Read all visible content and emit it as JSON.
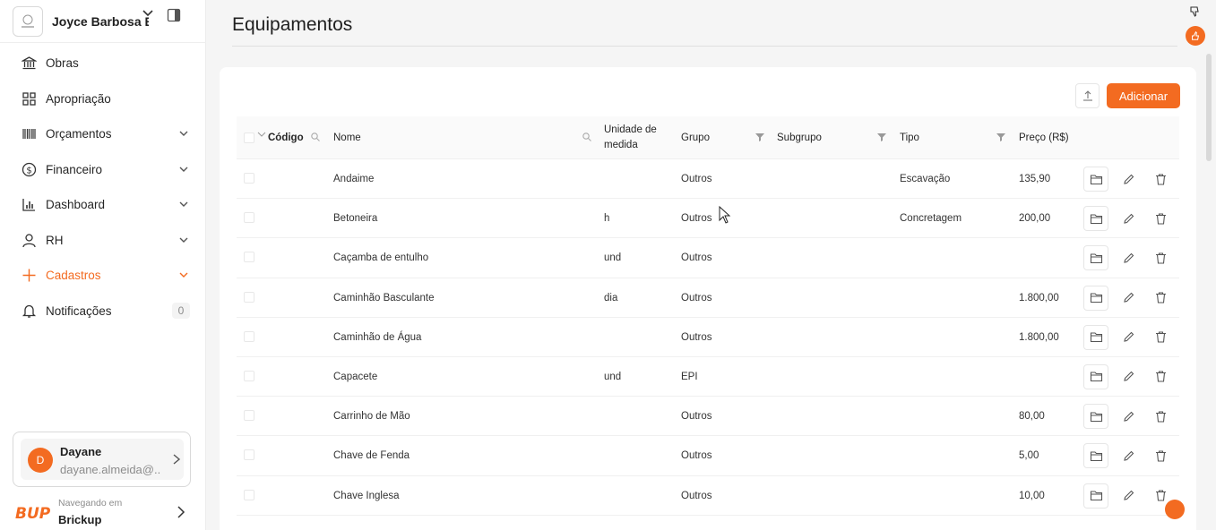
{
  "company": {
    "name": "Joyce Barbosa E..."
  },
  "nav": [
    {
      "label": "Obras",
      "icon": "bank-icon",
      "chevron": false
    },
    {
      "label": "Apropriação",
      "icon": "grid-icon",
      "chevron": false
    },
    {
      "label": "Orçamentos",
      "icon": "barcode-icon",
      "chevron": true
    },
    {
      "label": "Financeiro",
      "icon": "dollar-circle-icon",
      "chevron": true
    },
    {
      "label": "Dashboard",
      "icon": "bar-chart-icon",
      "chevron": true
    },
    {
      "label": "RH",
      "icon": "user-icon",
      "chevron": true
    },
    {
      "label": "Cadastros",
      "icon": "plus-icon",
      "chevron": true,
      "active": true
    },
    {
      "label": "Notificações",
      "icon": "bell-icon",
      "chevron": false,
      "badge": "0"
    }
  ],
  "user": {
    "initial": "D",
    "name": "Dayane",
    "email": "dayane.almeida@..."
  },
  "brand": {
    "logo_text": "BUP",
    "subtitle": "Navegando em",
    "name": "Brickup"
  },
  "page": {
    "title": "Equipamentos",
    "add_label": "Adicionar"
  },
  "table": {
    "headers": {
      "codigo": "Código",
      "nome": "Nome",
      "unidade_line1": "Unidade de",
      "unidade_line2": "medida",
      "grupo": "Grupo",
      "subgrupo": "Subgrupo",
      "tipo": "Tipo",
      "preco": "Preço (R$)"
    },
    "rows": [
      {
        "nome": "Andaime",
        "unidade": "",
        "grupo": "Outros",
        "subgrupo": "",
        "tipo": "Escavação",
        "preco": "135,90"
      },
      {
        "nome": "Betoneira",
        "unidade": "h",
        "grupo": "Outros",
        "subgrupo": "",
        "tipo": "Concretagem",
        "preco": "200,00"
      },
      {
        "nome": "Caçamba de entulho",
        "unidade": "und",
        "grupo": "Outros",
        "subgrupo": "",
        "tipo": "",
        "preco": ""
      },
      {
        "nome": "Caminhão Basculante",
        "unidade": "dia",
        "grupo": "Outros",
        "subgrupo": "",
        "tipo": "",
        "preco": "1.800,00"
      },
      {
        "nome": "Caminhão de Água",
        "unidade": "",
        "grupo": "Outros",
        "subgrupo": "",
        "tipo": "",
        "preco": "1.800,00"
      },
      {
        "nome": "Capacete",
        "unidade": "und",
        "grupo": "EPI",
        "subgrupo": "",
        "tipo": "",
        "preco": ""
      },
      {
        "nome": "Carrinho de Mão",
        "unidade": "",
        "grupo": "Outros",
        "subgrupo": "",
        "tipo": "",
        "preco": "80,00"
      },
      {
        "nome": "Chave de Fenda",
        "unidade": "",
        "grupo": "Outros",
        "subgrupo": "",
        "tipo": "",
        "preco": "5,00"
      },
      {
        "nome": "Chave Inglesa",
        "unidade": "",
        "grupo": "Outros",
        "subgrupo": "",
        "tipo": "",
        "preco": "10,00"
      }
    ]
  },
  "colors": {
    "accent": "#f36b21"
  }
}
